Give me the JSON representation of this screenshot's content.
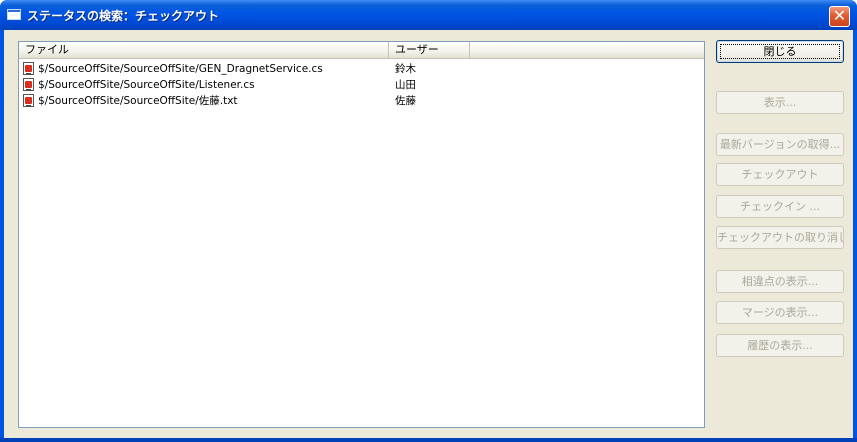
{
  "window": {
    "title": "ステータスの検索：チェックアウト",
    "close_glyph": "✕"
  },
  "list": {
    "columns": [
      {
        "label": "ファイル"
      },
      {
        "label": "ユーザー"
      }
    ],
    "rows": [
      {
        "file": "$/SourceOffSite/SourceOffSite/GEN_DragnetService.cs",
        "user": "鈴木"
      },
      {
        "file": "$/SourceOffSite/SourceOffSite/Listener.cs",
        "user": "山田"
      },
      {
        "file": "$/SourceOffSite/SourceOffSite/佐藤.txt",
        "user": "佐藤"
      }
    ]
  },
  "buttons": {
    "close": "閉じる",
    "show": "表示...",
    "get_latest": "最新バージョンの取得...",
    "checkout": "チェックアウト",
    "checkin": "チェックイン ...",
    "undo_checkout": "チェックアウトの取り消し",
    "show_diff": "相違点の表示...",
    "show_merge": "マージの表示...",
    "show_history": "履歴の表示..."
  },
  "colors": {
    "titlebar": "#0055e5",
    "dialog_bg": "#ece9d8",
    "close_button": "#e35a32"
  }
}
